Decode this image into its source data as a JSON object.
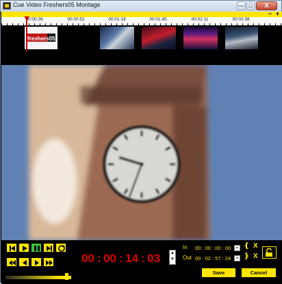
{
  "window": {
    "title": "Cue Video Freshers05 Montage",
    "caption_buttons": {
      "minimize": "—",
      "maximize": "□",
      "close": "X"
    }
  },
  "timeline": {
    "zoom_out": "−",
    "zoom_in": "+",
    "ticks": [
      "00:00:26",
      "00:00:52",
      "00:01:19",
      "00:01:45",
      "00:02:11",
      "00:02:38"
    ],
    "first_thumb_text": "freshers05"
  },
  "transport": {
    "timecode": {
      "hh": "00",
      "mm": "00",
      "ss": "14",
      "ff": "03"
    },
    "in": {
      "label": "In",
      "value": "00 : 00 : 00 : 00"
    },
    "out": {
      "label": "Out",
      "value": "00 : 02 : 57 : 24"
    },
    "x_mark": "X",
    "save_label": "Save",
    "cancel_label": "Cancel"
  },
  "colors": {
    "accent": "#ffe600",
    "timecode": "#e00000"
  }
}
